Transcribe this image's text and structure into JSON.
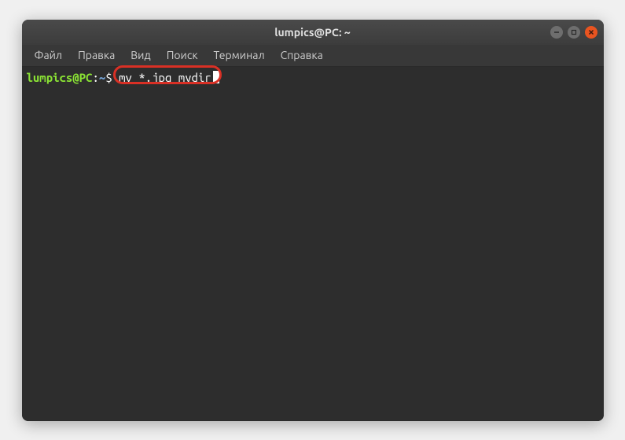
{
  "window": {
    "title": "lumpics@PC: ~"
  },
  "menubar": {
    "items": [
      "Файл",
      "Правка",
      "Вид",
      "Поиск",
      "Терминал",
      "Справка"
    ]
  },
  "terminal": {
    "prompt": {
      "user_host": "lumpics@PC",
      "separator": ":",
      "path": "~",
      "symbol": "$"
    },
    "command": "mv *.jpg mydir"
  },
  "colors": {
    "titlebar_text": "#e0e0e0",
    "close_btn": "#e95420",
    "prompt_user": "#8ae234",
    "prompt_path": "#729fcf",
    "terminal_bg": "#2d2d2d",
    "highlight_border": "#d93025"
  }
}
